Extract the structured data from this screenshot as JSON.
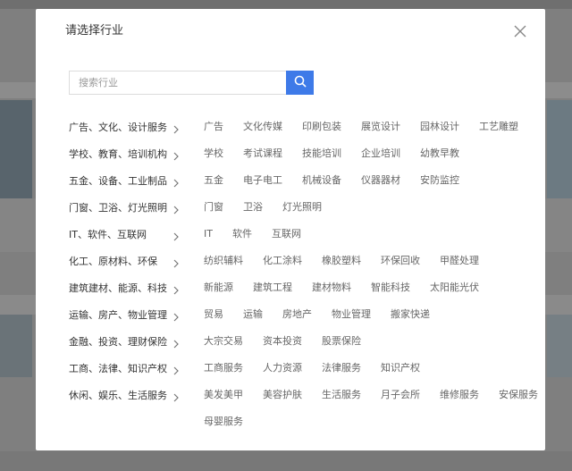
{
  "dialog": {
    "title": "请选择行业",
    "close_icon": "close-icon"
  },
  "search": {
    "placeholder": "搜索行业",
    "value": "",
    "button_icon": "search-icon",
    "button_color": "#3e7ae8"
  },
  "categories": [
    {
      "label": "广告、文化、设计服务",
      "subs": [
        "广告",
        "文化传媒",
        "印刷包装",
        "展览设计",
        "园林设计",
        "工艺雕塑"
      ]
    },
    {
      "label": "学校、教育、培训机构",
      "subs": [
        "学校",
        "考试课程",
        "技能培训",
        "企业培训",
        "幼教早教"
      ]
    },
    {
      "label": "五金、设备、工业制品",
      "subs": [
        "五金",
        "电子电工",
        "机械设备",
        "仪器器材",
        "安防监控"
      ]
    },
    {
      "label": "门窗、卫浴、灯光照明",
      "subs": [
        "门窗",
        "卫浴",
        "灯光照明"
      ]
    },
    {
      "label": "IT、软件、互联网",
      "subs": [
        "IT",
        "软件",
        "互联网"
      ]
    },
    {
      "label": "化工、原材料、环保",
      "subs": [
        "纺织辅料",
        "化工涂料",
        "橡胶塑料",
        "环保回收",
        "甲醛处理"
      ]
    },
    {
      "label": "建筑建材、能源、科技",
      "subs": [
        "新能源",
        "建筑工程",
        "建材物料",
        "智能科技",
        "太阳能光伏"
      ]
    },
    {
      "label": "运输、房产、物业管理",
      "subs": [
        "贸易",
        "运输",
        "房地产",
        "物业管理",
        "搬家快递"
      ]
    },
    {
      "label": "金融、投资、理财保险",
      "subs": [
        "大宗交易",
        "资本投资",
        "股票保险"
      ]
    },
    {
      "label": "工商、法律、知识产权",
      "subs": [
        "工商服务",
        "人力资源",
        "法律服务",
        "知识产权"
      ]
    },
    {
      "label": "休闲、娱乐、生活服务",
      "subs": [
        "美发美甲",
        "美容护肤",
        "生活服务",
        "月子会所",
        "维修服务",
        "安保服务"
      ],
      "subs_wrap": [
        "母婴服务"
      ]
    }
  ]
}
